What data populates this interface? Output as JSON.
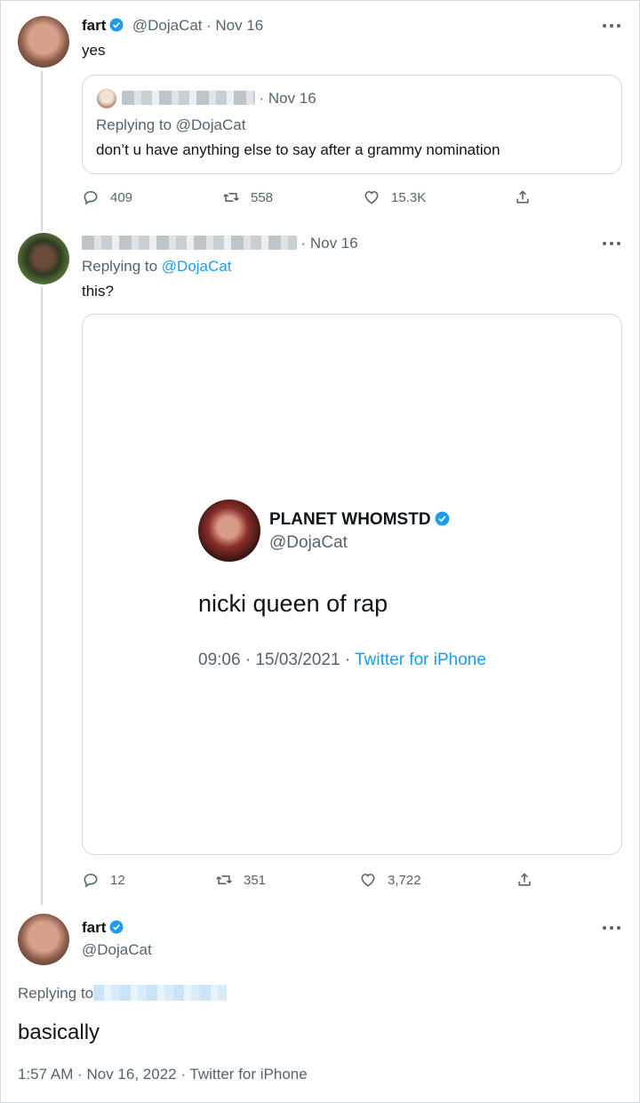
{
  "tweet1": {
    "name": "fart",
    "handle": "@DojaCat",
    "date": "· Nov 16",
    "text": "yes",
    "quote": {
      "date": "· Nov 16",
      "replying": "Replying to @DojaCat",
      "text": "don’t u have anything else to say after a grammy nomination"
    },
    "stats": {
      "replies": "409",
      "retweets": "558",
      "likes": "15.3K"
    }
  },
  "tweet2": {
    "date": "· Nov 16",
    "replying_prefix": "Replying to ",
    "replying_handle": "@DojaCat",
    "text": "this?",
    "embedded": {
      "name": "PLANET WHOMSTD",
      "handle": "@DojaCat",
      "text": "nicki queen of rap",
      "meta": "09:06 · 15/03/2021 · ",
      "source": "Twitter for iPhone"
    },
    "stats": {
      "replies": "12",
      "retweets": "351",
      "likes": "3,722"
    }
  },
  "tweet3": {
    "name": "fart",
    "handle": "@DojaCat",
    "replying_prefix": "Replying to",
    "text": "basically",
    "meta": "1:57 AM · Nov 16, 2022 · Twitter for iPhone"
  },
  "colors": {
    "accent": "#1d9bf0",
    "muted": "#536471",
    "border": "#cfd9de"
  },
  "icons": [
    "verified-badge-icon",
    "more-icon",
    "reply-icon",
    "retweet-icon",
    "like-icon",
    "share-icon"
  ]
}
